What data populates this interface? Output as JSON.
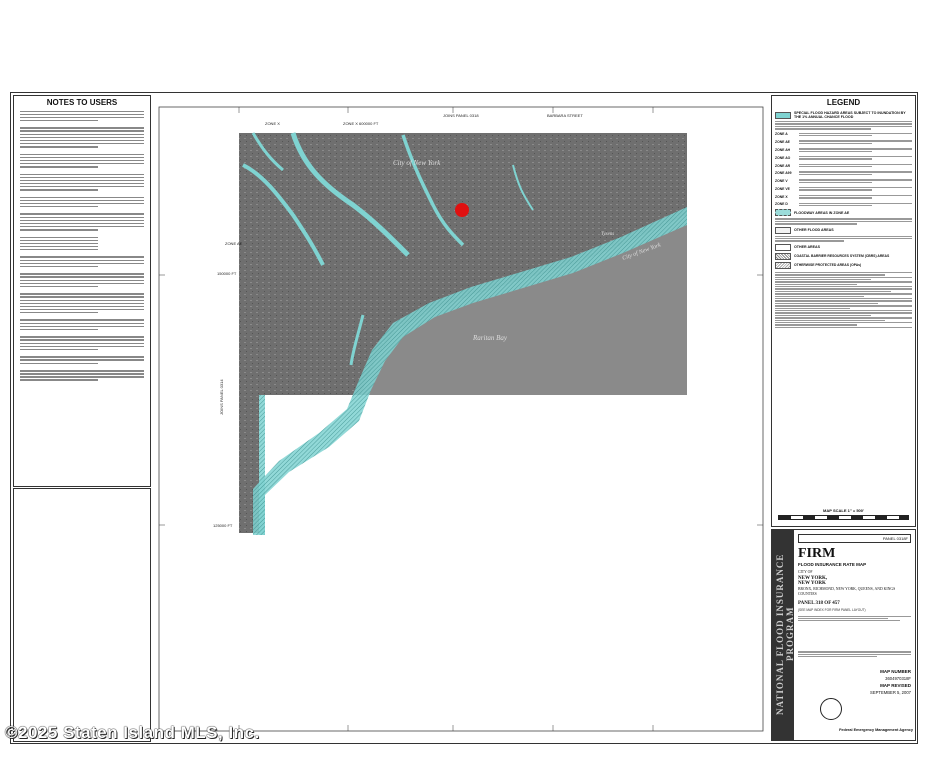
{
  "notes": {
    "title": "NOTES TO USERS"
  },
  "legend": {
    "title": "LEGEND",
    "sfha_heading": "SPECIAL FLOOD HAZARD AREAS SUBJECT TO INUNDATION BY THE 1% ANNUAL CHANCE FLOOD",
    "floodway_heading": "FLOODWAY AREAS IN ZONE AE",
    "other_areas_heading": "OTHER FLOOD AREAS",
    "other_heading": "OTHER AREAS",
    "cbrs_heading": "COASTAL BARRIER RESOURCES SYSTEM (CBRS) AREAS",
    "opa_heading": "OTHERWISE PROTECTED AREAS (OPAs)",
    "scale_label": "MAP SCALE 1\" = 500'",
    "zones": [
      "ZONE A",
      "ZONE AE",
      "ZONE AH",
      "ZONE AO",
      "ZONE AR",
      "ZONE A99",
      "ZONE V",
      "ZONE VE",
      "ZONE X",
      "ZONE D"
    ]
  },
  "map": {
    "labels": {
      "zone_x_left": "ZONE X",
      "zone_x_top": "ZONE X",
      "zone_ae": "ZONE AE",
      "city_1": "City of New York",
      "city_2": "City of New York",
      "raritan_bay": "Raritan Bay",
      "tysen_s": "Tysens",
      "panel_top_left": "JOINS PANEL 0318",
      "street_top": "BARBARA STREET",
      "coord_top": "600000 FT",
      "coord_left": "150000 FT",
      "coord_bottom_left": "125000 FT",
      "joins_left": "JOINS PANEL 0314"
    },
    "colors": {
      "flood_zone": "#7fd3d1",
      "land": "#6f6f6f",
      "water": "#8a8a8a",
      "subject_marker": "#e01010"
    }
  },
  "titleblock": {
    "panel_tag": "PANEL 0318F",
    "nfip_strip": "NATIONAL FLOOD INSURANCE PROGRAM",
    "firm": "FIRM",
    "firm_sub": "FLOOD INSURANCE RATE MAP",
    "city_of": "CITY OF",
    "city_name": "NEW YORK,",
    "state": "NEW YORK",
    "counties": "BRONX, RICHMOND, NEW YORK, QUEENS, AND KINGS COUNTIES",
    "panel_of": "PANEL 318 OF 457",
    "panel_note": "(SEE MAP INDEX FOR FIRM PANEL LAYOUT)",
    "map_number_label": "MAP NUMBER",
    "map_number": "3604970318F",
    "map_revised_label": "MAP REVISED",
    "map_revised": "SEPTEMBER 5, 2007",
    "agency": "Federal Emergency Management Agency"
  },
  "watermark": "©2025 Staten Island MLS, Inc."
}
